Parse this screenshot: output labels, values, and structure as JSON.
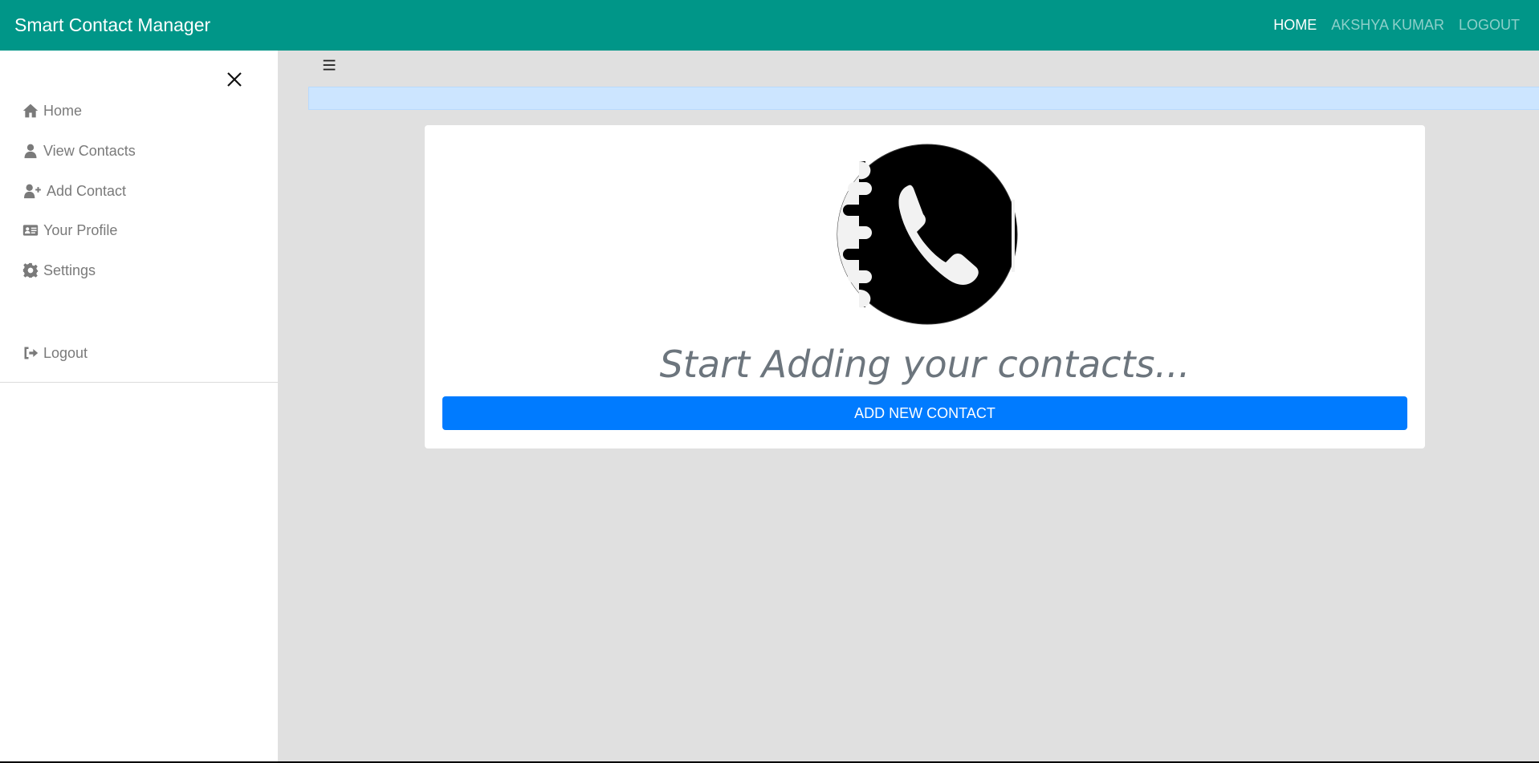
{
  "navbar": {
    "brand": "Smart Contact Manager",
    "links": [
      "HOME",
      "AKSHYA KUMAR",
      "LOGOUT"
    ]
  },
  "sidebar": {
    "items": [
      {
        "label": "Home",
        "icon": "home-icon"
      },
      {
        "label": "View Contacts",
        "icon": "user-icon"
      },
      {
        "label": "Add Contact",
        "icon": "user-plus-icon"
      },
      {
        "label": "Your Profile",
        "icon": "id-card-icon"
      },
      {
        "label": "Settings",
        "icon": "gear-icon"
      },
      {
        "label": "Logout",
        "icon": "sign-out-icon"
      }
    ]
  },
  "main": {
    "heading": "Start Adding your contacts...",
    "button_label": "ADD NEW CONTACT"
  },
  "colors": {
    "navbar": "#009688",
    "primary_button": "#007bff",
    "alert": "#cce5ff",
    "background": "#e0e0e0"
  }
}
